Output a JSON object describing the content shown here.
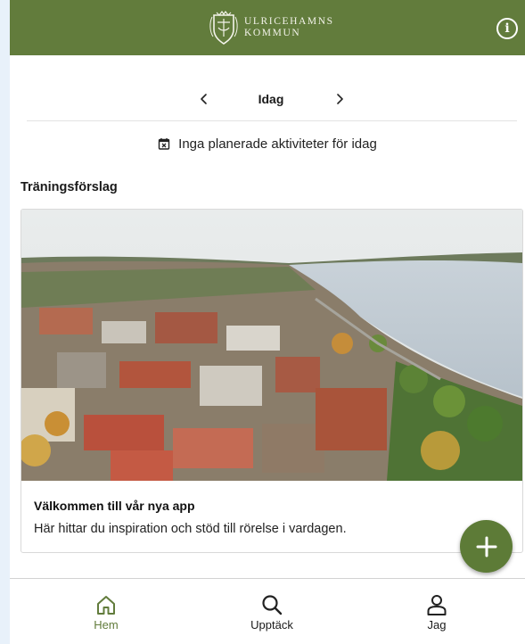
{
  "header": {
    "logo_line1": "ULRICEHAMNS",
    "logo_line2": "KOMMUN",
    "logo_icon": "coat-of-arms",
    "info_icon": "info-icon",
    "info_glyph": "i",
    "bg_color": "#627c3c"
  },
  "date_nav": {
    "prev_icon": "chevron-left-icon",
    "label": "Idag",
    "next_icon": "chevron-right-icon"
  },
  "no_activities": {
    "icon": "calendar-x-icon",
    "text": "Inga planerade aktiviteter för idag"
  },
  "suggestions": {
    "title": "Träningsförslag",
    "card": {
      "image": "aerial-town-photo",
      "title": "Välkommen till vår nya app",
      "description": "Här hittar du inspiration och stöd till rörelse i vardagen."
    }
  },
  "fab": {
    "icon": "plus-icon",
    "color": "#5d7b37"
  },
  "bottom_nav": {
    "items": [
      {
        "label": "Hem",
        "icon": "home-icon",
        "active": true
      },
      {
        "label": "Upptäck",
        "icon": "search-icon",
        "active": false
      },
      {
        "label": "Jag",
        "icon": "user-icon",
        "active": false
      }
    ],
    "active_color": "#627c3c"
  }
}
